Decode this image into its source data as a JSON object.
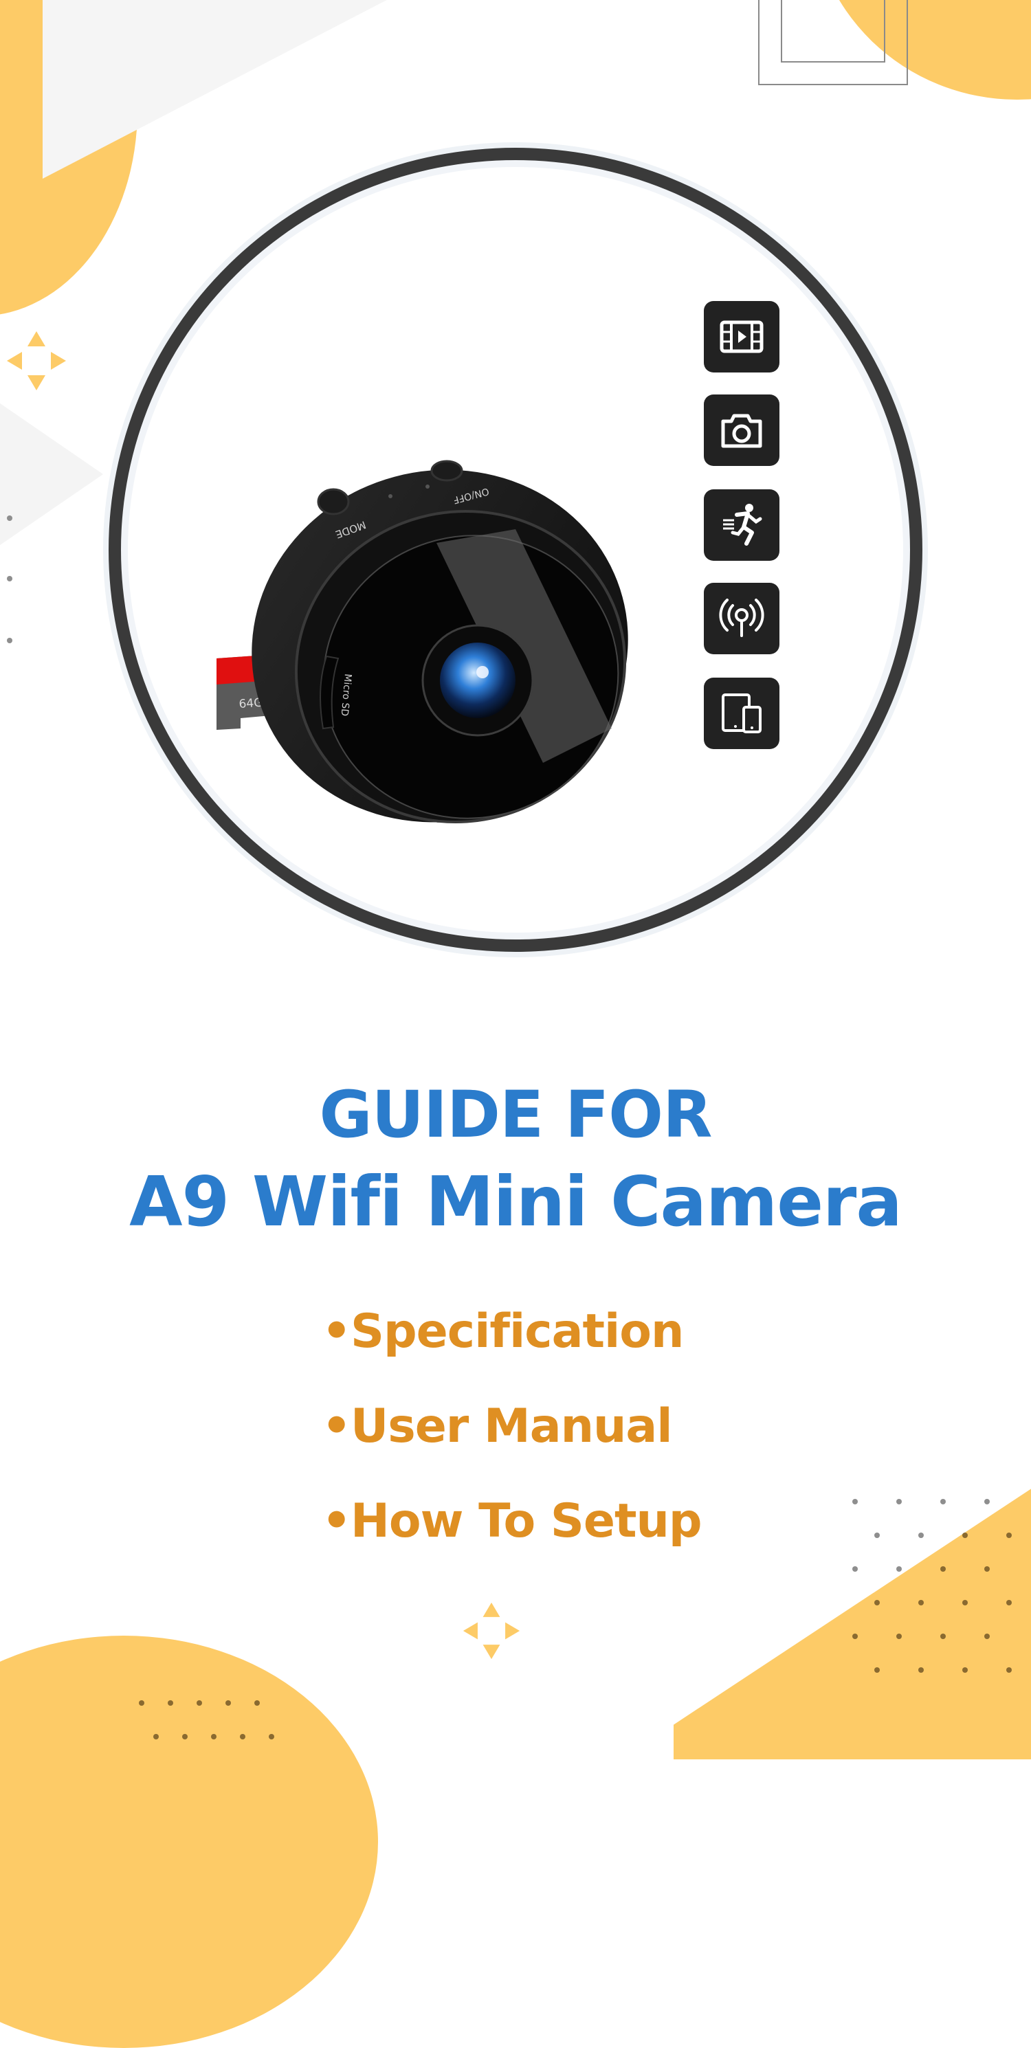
{
  "cover": {
    "title_line_1": "GUIDE FOR",
    "title_line_2": "A9 Wifi Mini Camera",
    "bullet_char": "•",
    "bullets": [
      "Specification",
      "User Manual",
      "How To Setup"
    ]
  },
  "product": {
    "name": "A9 Wifi Mini Camera",
    "labels": {
      "mode_button": "MODE",
      "power_button": "ON/OFF",
      "sd_slot": "Micro SD",
      "sd_card": "64GB"
    }
  },
  "features": [
    {
      "icon": "video-recording-icon"
    },
    {
      "icon": "photo-camera-icon"
    },
    {
      "icon": "motion-detection-icon"
    },
    {
      "icon": "wireless-signal-icon"
    },
    {
      "icon": "multi-device-icon"
    }
  ],
  "colors": {
    "title_blue": "#2B7CCC",
    "bullet_orange": "#DF8F22",
    "accent_yellow": "#FDCB67",
    "ring_dark": "#3a3a3a",
    "icon_tile": "#222222"
  }
}
